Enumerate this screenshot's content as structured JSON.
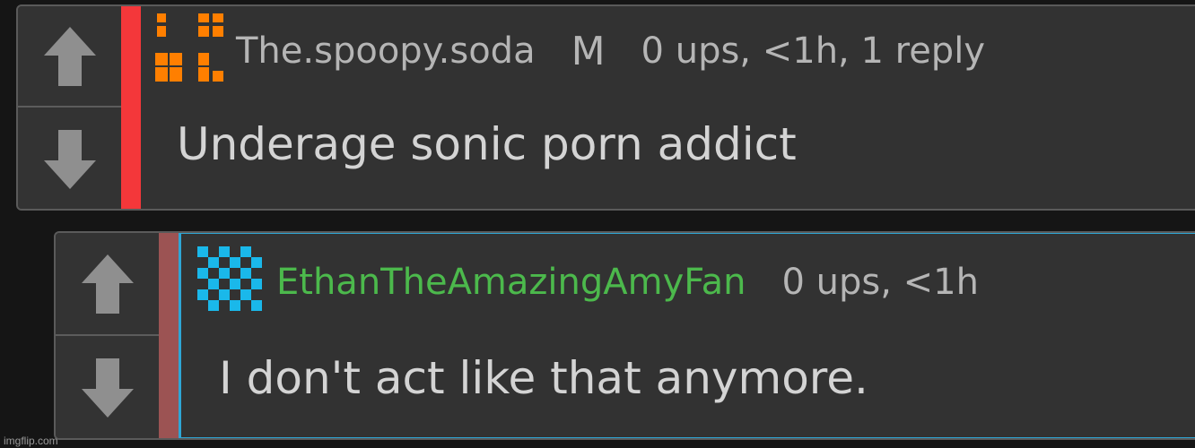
{
  "comments": [
    {
      "username": "The.spoopy.soda",
      "badge": "M",
      "meta": "0 ups, <1h, 1 reply",
      "text": "Underage sonic porn addict",
      "accent_color": "#f4373a",
      "avatar_color": "#ff7f00",
      "username_color": "#b5b5b5"
    },
    {
      "username": "EthanTheAmazingAmyFan",
      "meta": "0 ups, <1h",
      "text": "I don't act like that anymore.",
      "accent_color": "#9c5353",
      "avatar_color": "#1ab8ea",
      "username_color": "#4cb94c"
    }
  ],
  "icons": {
    "upvote": "up-arrow-icon",
    "downvote": "down-arrow-icon"
  },
  "watermark": "imgflip.com"
}
